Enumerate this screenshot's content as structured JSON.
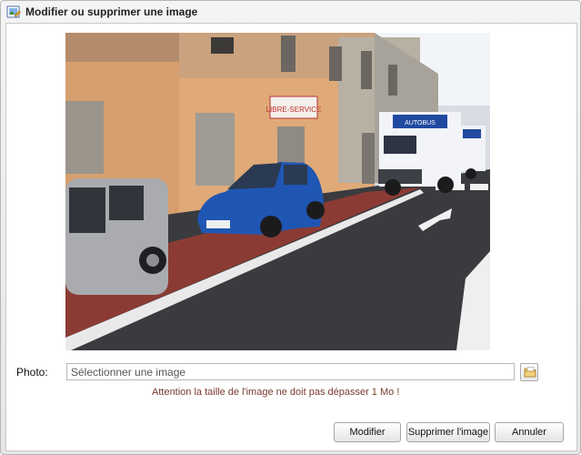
{
  "dialog": {
    "title": "Modifier ou supprimer une image"
  },
  "photo_field": {
    "label": "Photo:",
    "placeholder": "Sélectionner une image",
    "value": ""
  },
  "warning": "Attention la taille de l'image ne doit pas dépasser 1 Mo !",
  "image": {
    "shop_sign": "LIBRE-SERVICE",
    "truck_lettering": "AUTOBUS"
  },
  "buttons": {
    "modify": "Modifier",
    "delete": "Supprimer l'image",
    "cancel": "Annuler"
  },
  "icons": {
    "title": "image-edit-icon",
    "browse": "folder-icon"
  }
}
